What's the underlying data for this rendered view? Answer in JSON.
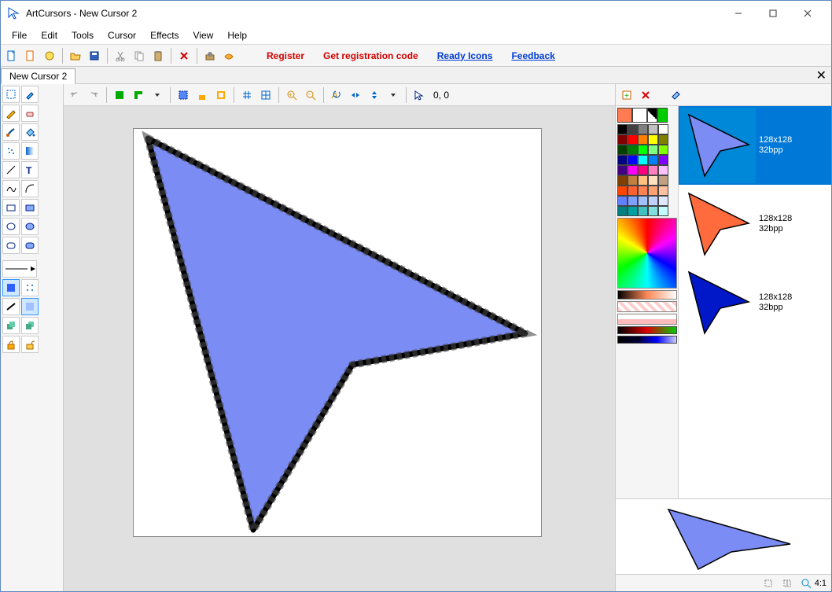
{
  "title": "ArtCursors - New Cursor 2",
  "menu": {
    "file": "File",
    "edit": "Edit",
    "tools": "Tools",
    "cursor": "Cursor",
    "effects": "Effects",
    "view": "View",
    "help": "Help"
  },
  "links": {
    "register": "Register",
    "getcode": "Get registration code",
    "readyicons": "Ready Icons",
    "feedback": "Feedback"
  },
  "tab": {
    "name": "New Cursor 2"
  },
  "coords": "0, 0",
  "palette_rows": [
    [
      "#ff7b52",
      "#ffffff",
      "#000000",
      "#transparent",
      "#invert"
    ],
    [
      "#000000",
      "#404040",
      "#808080",
      "#c0c0c0",
      "#ffffff"
    ],
    [
      "#800000",
      "#ff0000",
      "#ff8000",
      "#ffff00",
      "#808000"
    ],
    [
      "#004000",
      "#008000",
      "#00ff00",
      "#80ff80",
      "#80ff00"
    ],
    [
      "#000080",
      "#0000ff",
      "#00ffff",
      "#0080ff",
      "#8000ff"
    ],
    [
      "#400080",
      "#ff00ff",
      "#ff0080",
      "#ff80c0",
      "#ffc0ff"
    ],
    [
      "#804000",
      "#c08040",
      "#ffc080",
      "#ffe0c0",
      "#c0a080"
    ],
    [
      "#ff4500",
      "#ff6030",
      "#ff8050",
      "#ffa070",
      "#ffc0a0"
    ],
    [
      "#6080ff",
      "#80a0ff",
      "#a0c0ff",
      "#c0d0ff",
      "#e0e8ff"
    ],
    [
      "#008080",
      "#00a0a0",
      "#40c0c0",
      "#80e0e0",
      "#c0ffff"
    ]
  ],
  "previews": [
    {
      "size": "128x128",
      "bpp": "32bpp",
      "color": "#7b8cf5"
    },
    {
      "size": "128x128",
      "bpp": "32bpp",
      "color": "#ff6b3d"
    },
    {
      "size": "128x128",
      "bpp": "32bpp",
      "color": "#0018c8"
    }
  ],
  "status": {
    "zoom": "4:1"
  }
}
